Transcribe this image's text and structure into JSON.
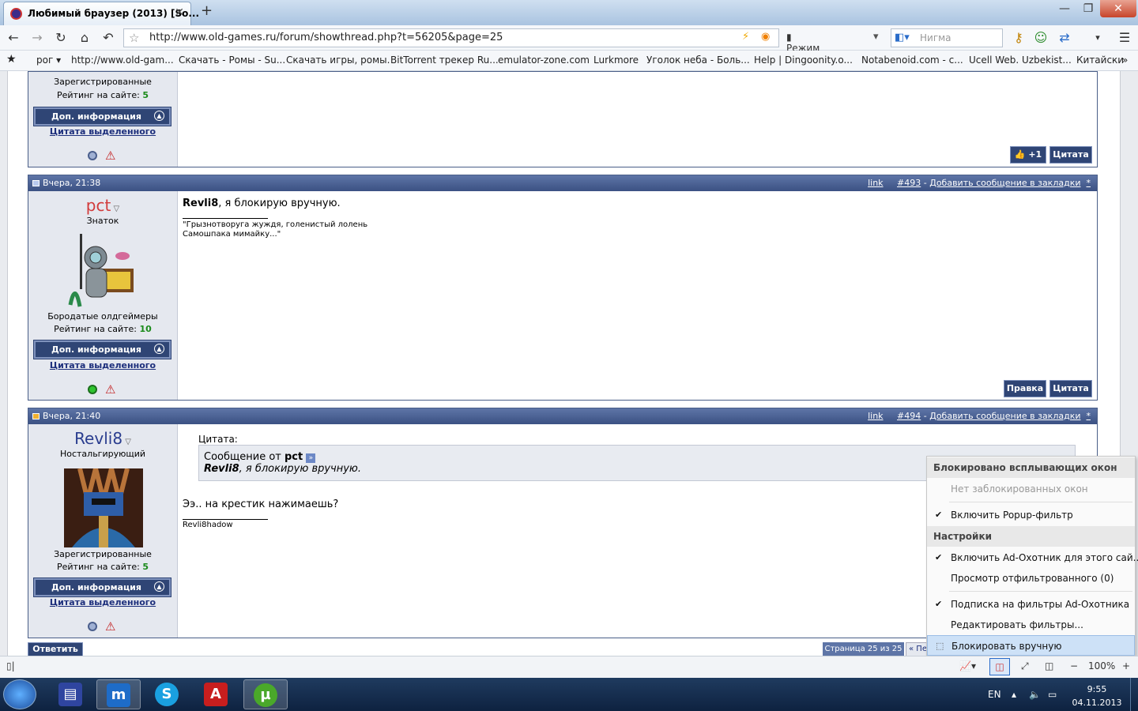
{
  "browser": {
    "tab_title": "Любимый браузер (2013) [So...",
    "url": "http://www.old-games.ru/forum/showthread.php?t=56205&page=25",
    "reader_mode": "Режим чтения",
    "search_placeholder": "Нигма"
  },
  "bookmarks": [
    "рог ▾",
    "http://www.old-gam...",
    "Скачать - Ромы - Su...",
    "Скачать игры, ромы.",
    "BitTorrent трекер Ru...",
    "emulator-zone.com",
    "Lurkmore",
    "Уголок неба - Боль...",
    "Help | Dingoonity.o...",
    "Notabenoid.com - с...",
    "Ucell Web. Uzbekist...",
    "Китайски"
  ],
  "posts": [
    {
      "user_title": "Зарегистрированные",
      "rating_label": "Рейтинг на сайте:",
      "rating": "5",
      "info_btn": "Доп. информация",
      "quote_sel": "Цитата выделенного",
      "btn_plus": "+1",
      "btn_quote": "Цитата"
    },
    {
      "date": "Вчера, 21:38",
      "link": "link",
      "num": "#493",
      "bookmark": "Добавить сообщение в закладки",
      "username": "pct",
      "rank": "Знаток",
      "group": "Бородатые олдгеймеры",
      "rating_label": "Рейтинг на сайте:",
      "rating": "10",
      "info_btn": "Доп. информация",
      "quote_sel": "Цитата выделенного",
      "msg_bold": "Revli8",
      "msg_rest": ", я блокирую вручную.",
      "sig1": "\"Грызнотворуга жуждя, голенистый лолень",
      "sig2": "Самошпака мимайку...\"",
      "btn_edit": "Правка",
      "btn_quote": "Цитата"
    },
    {
      "date": "Вчера, 21:40",
      "link": "link",
      "num": "#494",
      "bookmark": "Добавить сообщение в закладки",
      "username": "Revli8",
      "rank": "Ностальгирующий",
      "group": "Зарегистрированные",
      "rating_label": "Рейтинг на сайте:",
      "rating": "5",
      "info_btn": "Доп. информация",
      "quote_sel": "Цитата выделенного",
      "quote_label": "Цитата:",
      "quote_from": "Сообщение от",
      "quote_author": "pct",
      "quote_bold": "Revli8",
      "quote_rest": ", я блокирую вручную.",
      "msg": "Ээ.. на крестик нажимаешь?",
      "sig": "Revli8hadow"
    }
  ],
  "reply_btn": "Ответить",
  "page_info": "Страница 25 из 25",
  "page_prev": "« Пе",
  "menu": {
    "header1": "Блокировано всплывающих окон",
    "none": "Нет заблокированных окон",
    "popup": "Включить Popup-фильтр",
    "header2": "Настройки",
    "adhunter": "Включить Ad-Охотник для этого сай...",
    "view": "Просмотр отфильтрованного (0)",
    "subscribe": "Подписка на фильтры Ad-Охотника",
    "edit": "Редактировать фильтры...",
    "manual": "Блокировать вручную"
  },
  "status": {
    "zoom": "100%"
  },
  "tray": {
    "lang": "EN",
    "time": "9:55",
    "date": "04.11.2013"
  }
}
